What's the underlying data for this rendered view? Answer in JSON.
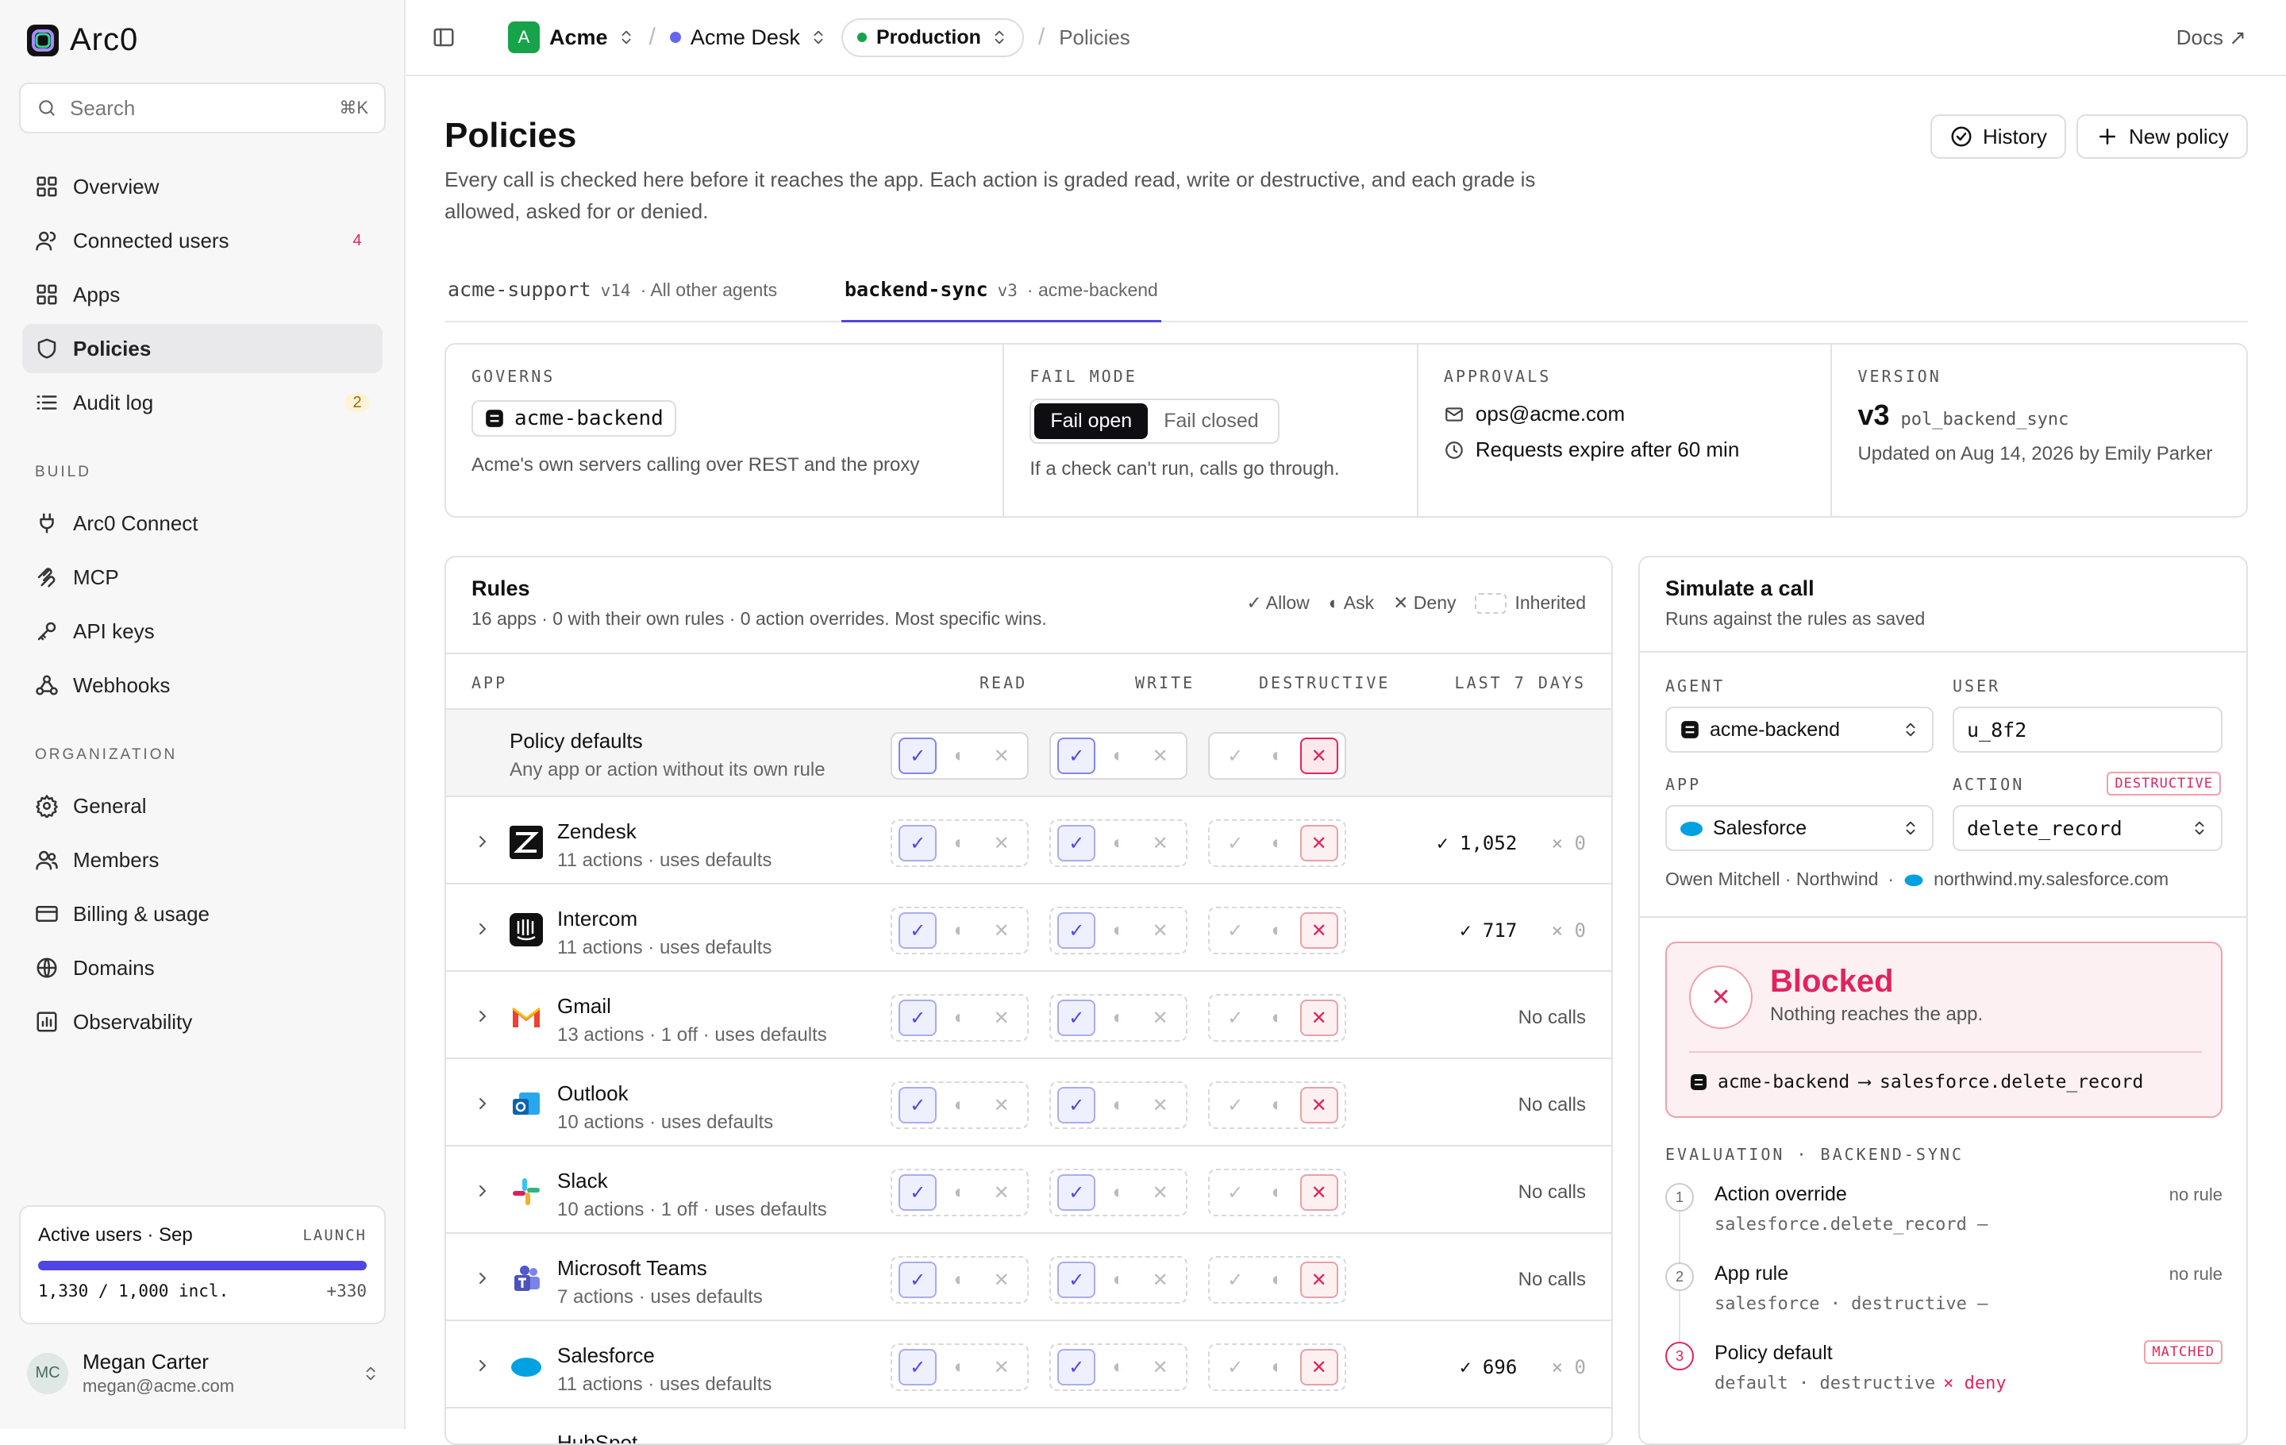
{
  "brand": {
    "name": "Arc0"
  },
  "search": {
    "placeholder": "Search",
    "shortcut": "⌘K"
  },
  "nav": [
    {
      "label": "Overview",
      "icon": "grid-icon",
      "count": ""
    },
    {
      "label": "Connected users",
      "icon": "users-icon",
      "count": "4"
    },
    {
      "label": "Apps",
      "icon": "apps-icon",
      "count": ""
    },
    {
      "label": "Policies",
      "icon": "shield-icon",
      "count": "",
      "active": true
    },
    {
      "label": "Audit log",
      "icon": "list-icon",
      "count": "2"
    }
  ],
  "sections": {
    "build": "BUILD",
    "organization": "ORGANIZATION"
  },
  "build_nav": [
    {
      "label": "Arc0 Connect",
      "icon": "plug-icon"
    },
    {
      "label": "MCP",
      "icon": "mcp-icon"
    },
    {
      "label": "API keys",
      "icon": "key-icon"
    },
    {
      "label": "Webhooks",
      "icon": "webhook-icon"
    }
  ],
  "org_nav": [
    {
      "label": "General",
      "icon": "gear-icon"
    },
    {
      "label": "Members",
      "icon": "members-icon"
    },
    {
      "label": "Billing & usage",
      "icon": "card-icon"
    },
    {
      "label": "Domains",
      "icon": "globe-icon"
    },
    {
      "label": "Observability",
      "icon": "chart-icon"
    }
  ],
  "usage": {
    "title": "Active users · Sep",
    "tag": "LAUNCH",
    "value": "1,330 / 1,000 incl.",
    "over": "+330",
    "fill": 1.0
  },
  "user": {
    "initials": "MC",
    "name": "Megan Carter",
    "email": "megan@acme.com"
  },
  "topbar": {
    "org": "Acme",
    "org_initial": "A",
    "project": "Acme Desk",
    "env": "Production",
    "page": "Policies",
    "docs": "Docs ↗"
  },
  "page": {
    "title": "Policies",
    "description": "Every call is checked here before it reaches the app. Each action is graded read, write or destructive, and each grade is allowed, asked for or denied.",
    "history": "History",
    "new_policy": "New policy"
  },
  "tabs": [
    {
      "name": "acme-support",
      "ver": "v14",
      "scope": "· All other agents"
    },
    {
      "name": "backend-sync",
      "ver": "v3",
      "scope": "· acme-backend",
      "active": true
    }
  ],
  "info": {
    "governs_label": "GOVERNS",
    "governs_value": "acme-backend",
    "governs_desc": "Acme's own servers calling over REST and the proxy",
    "fail_label": "FAIL MODE",
    "fail_open": "Fail open",
    "fail_closed": "Fail closed",
    "fail_desc": "If a check can't run, calls go through.",
    "approvals_label": "APPROVALS",
    "approvals_email": "ops@acme.com",
    "approvals_expire": "Requests expire after 60 min",
    "version_label": "VERSION",
    "version": "v3",
    "version_id": "pol_backend_sync",
    "version_updated": "Updated on Aug 14, 2026 by Emily Parker"
  },
  "rules": {
    "title": "Rules",
    "subtitle": "16 apps · 0 with their own rules · 0 action overrides. Most specific wins.",
    "legend": {
      "allow": "✓ Allow",
      "ask": "◐ Ask",
      "deny": "✕ Deny",
      "inherited": "Inherited"
    },
    "columns": {
      "app": "APP",
      "read": "READ",
      "write": "WRITE",
      "destructive": "DESTRUCTIVE",
      "last": "LAST 7 DAYS"
    },
    "defaults": {
      "name": "Policy defaults",
      "sub": "Any app or action without its own rule"
    },
    "rows": [
      {
        "name": "Zendesk",
        "sub": "11 actions · uses defaults",
        "allow": "✓ 1,052",
        "deny": "× 0",
        "icon": "zendesk-icon"
      },
      {
        "name": "Intercom",
        "sub": "11 actions · uses defaults",
        "allow": "✓ 717",
        "deny": "× 0",
        "icon": "intercom-icon"
      },
      {
        "name": "Gmail",
        "sub": "13 actions · 1 off · uses defaults",
        "allow": "No calls",
        "deny": "",
        "icon": "gmail-icon"
      },
      {
        "name": "Outlook",
        "sub": "10 actions · uses defaults",
        "allow": "No calls",
        "deny": "",
        "icon": "outlook-icon"
      },
      {
        "name": "Slack",
        "sub": "10 actions · 1 off · uses defaults",
        "allow": "No calls",
        "deny": "",
        "icon": "slack-icon"
      },
      {
        "name": "Microsoft Teams",
        "sub": "7 actions · uses defaults",
        "allow": "No calls",
        "deny": "",
        "icon": "teams-icon"
      },
      {
        "name": "Salesforce",
        "sub": "11 actions · uses defaults",
        "allow": "✓ 696",
        "deny": "× 0",
        "icon": "salesforce-icon"
      },
      {
        "name": "HubSpot",
        "sub": "",
        "allow": "",
        "deny": "",
        "icon": "hubspot-icon"
      }
    ]
  },
  "sim": {
    "title": "Simulate a call",
    "subtitle": "Runs against the rules as saved",
    "agent_label": "AGENT",
    "agent": "acme-backend",
    "user_label": "USER",
    "user": "u_8f2",
    "app_label": "APP",
    "app": "Salesforce",
    "action_label": "ACTION",
    "action_tag": "DESTRUCTIVE",
    "action": "delete_record",
    "context_user": "Owen Mitchell · Northwind",
    "context_domain": "northwind.my.salesforce.com",
    "result_title": "Blocked",
    "result_sub": "Nothing reaches the app.",
    "route_from": "acme-backend",
    "route_to": "salesforce.delete_record",
    "eval_label": "EVALUATION · BACKEND-SYNC",
    "steps": [
      {
        "n": "1",
        "title": "Action override",
        "detail": "salesforce.delete_record —",
        "status": "no rule"
      },
      {
        "n": "2",
        "title": "App rule",
        "detail": "salesforce · destructive —",
        "status": "no rule"
      },
      {
        "n": "3",
        "title": "Policy default",
        "detail": "default · destructive",
        "deny": "× deny",
        "status": "MATCHED"
      }
    ]
  },
  "colors": {
    "accent": "#4f46e5",
    "danger": "#e0245e",
    "sidebar": "#f7f7f8"
  }
}
